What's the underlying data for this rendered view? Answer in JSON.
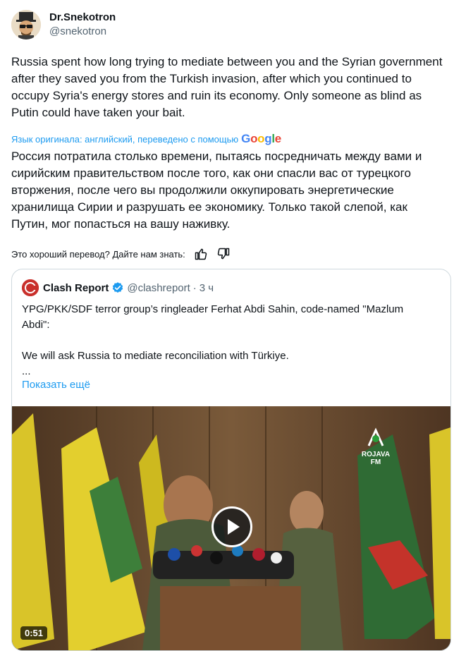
{
  "author": {
    "display_name": "Dr.Snekotron",
    "handle": "@snekotron"
  },
  "tweet": {
    "text": "Russia spent how long trying to mediate between you and the Syrian government after they saved you from the Turkish invasion, after which you continued to occupy Syria's energy stores and ruin its economy. Only someone as blind as Putin could have taken your bait.",
    "translated_notice": "Язык оригинала: английский, переведено с помощью",
    "translator_brand": "Google",
    "translation": "Россия потратила столько времени, пытаясь посредничать между вами и сирийским правительством после того, как они спасли вас от турецкого вторжения, после чего вы продолжили оккупировать энергетические хранилища Сирии и разрушать ее экономику. Только такой слепой, как Путин, мог попасться на вашу наживку.",
    "feedback_prompt": "Это хороший перевод? Дайте нам знать:"
  },
  "quote": {
    "display_name": "Clash Report",
    "handle": "@clashreport",
    "separator": "·",
    "time": "3 ч",
    "text": "YPG/PKK/SDF terror group’s ringleader Ferhat Abdi Sahin, code-named \"Mazlum Abdi\":\n\nWe will ask Russia to mediate reconciliation with Türkiye.\n...",
    "show_more": "Показать ещё",
    "avatar_text": "CLASH REPORT",
    "media": {
      "timestamp": "0:51",
      "watermark": "ROJAVA FM",
      "kind": "video"
    }
  },
  "colors": {
    "accent": "#1d9bf0",
    "text": "#0f1419",
    "muted": "#536471",
    "border": "#cfd9de"
  }
}
